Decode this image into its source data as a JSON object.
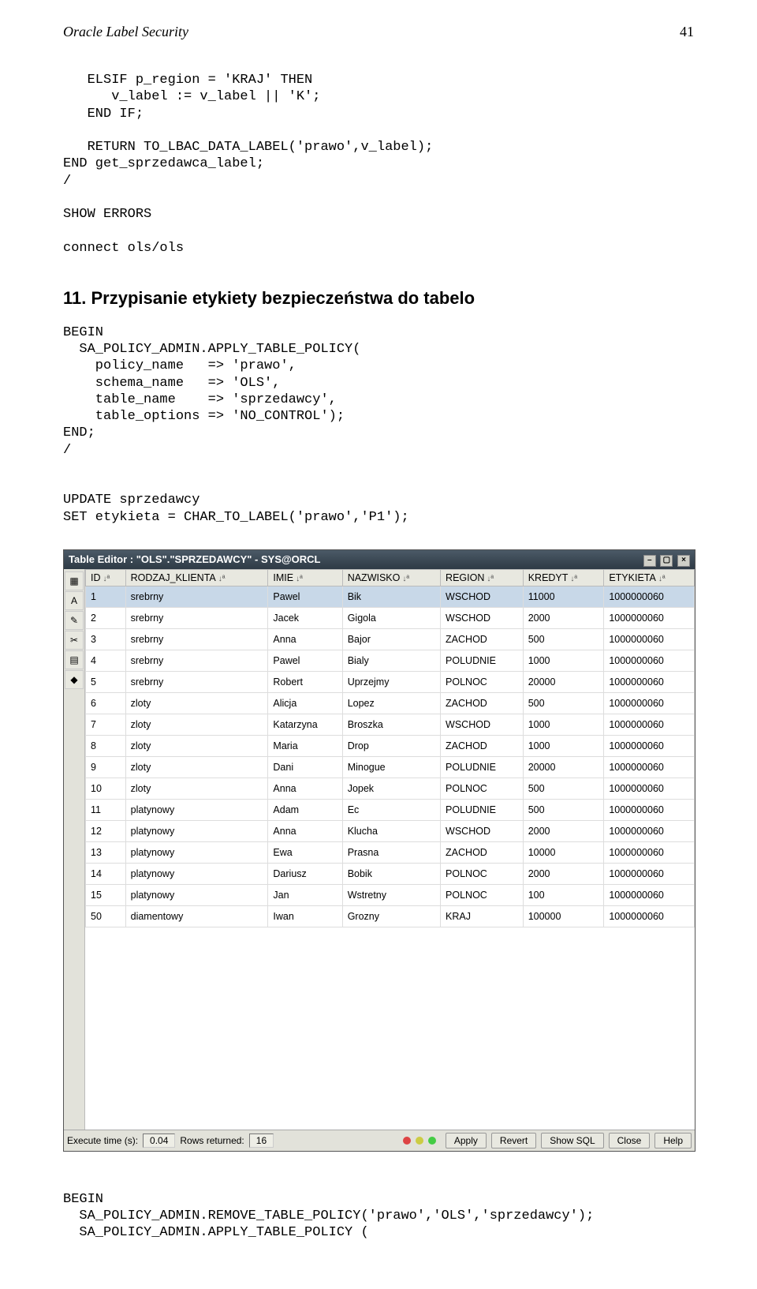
{
  "header": {
    "title": "Oracle Label Security",
    "page_number": "41"
  },
  "code_block_1": "   ELSIF p_region = 'KRAJ' THEN\n      v_label := v_label || 'K';\n   END IF;\n\n   RETURN TO_LBAC_DATA_LABEL('prawo',v_label);\nEND get_sprzedawca_label;\n/\n\nSHOW ERRORS\n\nconnect ols/ols",
  "section_heading": "11.   Przypisanie etykiety bezpieczeństwa do tabelo",
  "code_block_2": "BEGIN\n  SA_POLICY_ADMIN.APPLY_TABLE_POLICY(\n    policy_name   => 'prawo',\n    schema_name   => 'OLS',\n    table_name    => 'sprzedawcy',\n    table_options => 'NO_CONTROL');\nEND;\n/\n\n\nUPDATE sprzedawcy\nSET etykieta = CHAR_TO_LABEL('prawo','P1');",
  "table_window": {
    "title": "Table Editor : \"OLS\".\"SPRZEDAWCY\" - SYS@ORCL",
    "toolbar_icons": [
      "grid-icon",
      "text-icon",
      "pencil-icon",
      "doc-icon",
      "page-icon",
      "db-icon"
    ],
    "columns": [
      "ID",
      "RODZAJ_KLIENTA",
      "IMIE",
      "NAZWISKO",
      "REGION",
      "KREDYT",
      "ETYKIETA"
    ],
    "rows": [
      {
        "id": "1",
        "rodzaj": "srebrny",
        "imie": "Pawel",
        "naz": "Bik",
        "region": "WSCHOD",
        "kredyt": "11000",
        "ety": "1000000060"
      },
      {
        "id": "2",
        "rodzaj": "srebrny",
        "imie": "Jacek",
        "naz": "Gigola",
        "region": "WSCHOD",
        "kredyt": "2000",
        "ety": "1000000060"
      },
      {
        "id": "3",
        "rodzaj": "srebrny",
        "imie": "Anna",
        "naz": "Bajor",
        "region": "ZACHOD",
        "kredyt": "500",
        "ety": "1000000060"
      },
      {
        "id": "4",
        "rodzaj": "srebrny",
        "imie": "Pawel",
        "naz": "Bialy",
        "region": "POLUDNIE",
        "kredyt": "1000",
        "ety": "1000000060"
      },
      {
        "id": "5",
        "rodzaj": "srebrny",
        "imie": "Robert",
        "naz": "Uprzejmy",
        "region": "POLNOC",
        "kredyt": "20000",
        "ety": "1000000060"
      },
      {
        "id": "6",
        "rodzaj": "zloty",
        "imie": "Alicja",
        "naz": "Lopez",
        "region": "ZACHOD",
        "kredyt": "500",
        "ety": "1000000060"
      },
      {
        "id": "7",
        "rodzaj": "zloty",
        "imie": "Katarzyna",
        "naz": "Broszka",
        "region": "WSCHOD",
        "kredyt": "1000",
        "ety": "1000000060"
      },
      {
        "id": "8",
        "rodzaj": "zloty",
        "imie": "Maria",
        "naz": "Drop",
        "region": "ZACHOD",
        "kredyt": "1000",
        "ety": "1000000060"
      },
      {
        "id": "9",
        "rodzaj": "zloty",
        "imie": "Dani",
        "naz": "Minogue",
        "region": "POLUDNIE",
        "kredyt": "20000",
        "ety": "1000000060"
      },
      {
        "id": "10",
        "rodzaj": "zloty",
        "imie": "Anna",
        "naz": "Jopek",
        "region": "POLNOC",
        "kredyt": "500",
        "ety": "1000000060"
      },
      {
        "id": "11",
        "rodzaj": "platynowy",
        "imie": "Adam",
        "naz": "Ec",
        "region": "POLUDNIE",
        "kredyt": "500",
        "ety": "1000000060"
      },
      {
        "id": "12",
        "rodzaj": "platynowy",
        "imie": "Anna",
        "naz": "Klucha",
        "region": "WSCHOD",
        "kredyt": "2000",
        "ety": "1000000060"
      },
      {
        "id": "13",
        "rodzaj": "platynowy",
        "imie": "Ewa",
        "naz": "Prasna",
        "region": "ZACHOD",
        "kredyt": "10000",
        "ety": "1000000060"
      },
      {
        "id": "14",
        "rodzaj": "platynowy",
        "imie": "Dariusz",
        "naz": "Bobik",
        "region": "POLNOC",
        "kredyt": "2000",
        "ety": "1000000060"
      },
      {
        "id": "15",
        "rodzaj": "platynowy",
        "imie": "Jan",
        "naz": "Wstretny",
        "region": "POLNOC",
        "kredyt": "100",
        "ety": "1000000060"
      },
      {
        "id": "50",
        "rodzaj": "diamentowy",
        "imie": "Iwan",
        "naz": "Grozny",
        "region": "KRAJ",
        "kredyt": "100000",
        "ety": "1000000060"
      }
    ],
    "status": {
      "exec_label": "Execute time (s):",
      "exec_value": "0.04",
      "rows_label": "Rows returned:",
      "rows_value": "16",
      "buttons": {
        "apply": "Apply",
        "revert": "Revert",
        "showsql": "Show SQL",
        "close": "Close",
        "help": "Help"
      }
    }
  },
  "code_block_3": "BEGIN\n  SA_POLICY_ADMIN.REMOVE_TABLE_POLICY('prawo','OLS','sprzedawcy');\n  SA_POLICY_ADMIN.APPLY_TABLE_POLICY ("
}
